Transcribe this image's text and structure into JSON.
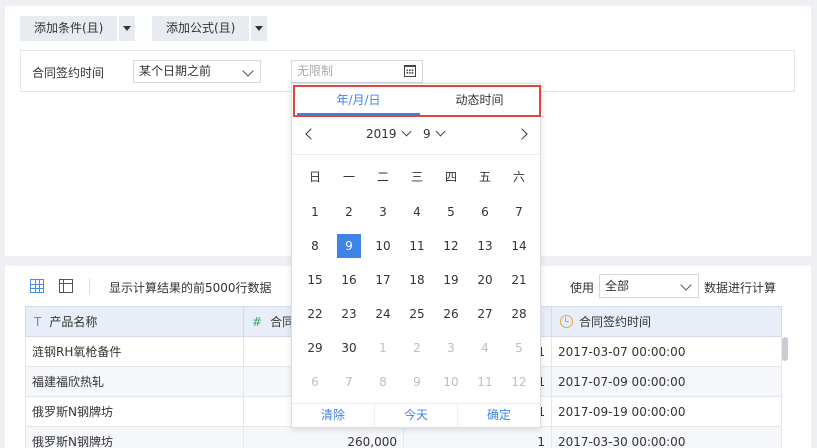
{
  "toolbar": {
    "add_condition_label": "添加条件(且)",
    "add_formula_label": "添加公式(且)"
  },
  "filter": {
    "field_label": "合同签约时间",
    "operator_value": "某个日期之前",
    "date_placeholder": "无限制"
  },
  "datepicker": {
    "tabs": [
      "年/月/日",
      "动态时间"
    ],
    "active_tab": "年/月/日",
    "year": "2019",
    "month": "9",
    "weekdays": [
      "日",
      "一",
      "二",
      "三",
      "四",
      "五",
      "六"
    ],
    "days": [
      {
        "d": "1",
        "o": false
      },
      {
        "d": "2",
        "o": false
      },
      {
        "d": "3",
        "o": false
      },
      {
        "d": "4",
        "o": false
      },
      {
        "d": "5",
        "o": false
      },
      {
        "d": "6",
        "o": false
      },
      {
        "d": "7",
        "o": false
      },
      {
        "d": "8",
        "o": false
      },
      {
        "d": "9",
        "o": false,
        "s": true
      },
      {
        "d": "10",
        "o": false
      },
      {
        "d": "11",
        "o": false
      },
      {
        "d": "12",
        "o": false
      },
      {
        "d": "13",
        "o": false
      },
      {
        "d": "14",
        "o": false
      },
      {
        "d": "15",
        "o": false
      },
      {
        "d": "16",
        "o": false
      },
      {
        "d": "17",
        "o": false
      },
      {
        "d": "18",
        "o": false
      },
      {
        "d": "19",
        "o": false
      },
      {
        "d": "20",
        "o": false
      },
      {
        "d": "21",
        "o": false
      },
      {
        "d": "22",
        "o": false
      },
      {
        "d": "23",
        "o": false
      },
      {
        "d": "24",
        "o": false
      },
      {
        "d": "25",
        "o": false
      },
      {
        "d": "26",
        "o": false
      },
      {
        "d": "27",
        "o": false
      },
      {
        "d": "28",
        "o": false
      },
      {
        "d": "29",
        "o": false
      },
      {
        "d": "30",
        "o": false
      },
      {
        "d": "1",
        "o": true
      },
      {
        "d": "2",
        "o": true
      },
      {
        "d": "3",
        "o": true
      },
      {
        "d": "4",
        "o": true
      },
      {
        "d": "5",
        "o": true
      },
      {
        "d": "6",
        "o": true
      },
      {
        "d": "7",
        "o": true
      },
      {
        "d": "8",
        "o": true
      },
      {
        "d": "9",
        "o": true
      },
      {
        "d": "10",
        "o": true
      },
      {
        "d": "11",
        "o": true
      },
      {
        "d": "12",
        "o": true
      }
    ],
    "footer": {
      "clear": "清除",
      "today": "今天",
      "confirm": "确定"
    }
  },
  "preview": {
    "info_text": "显示计算结果的前5000行数据",
    "use_label": "使用",
    "use_value": "全部",
    "use_suffix": "数据进行计算",
    "columns": [
      {
        "type": "T",
        "label": "产品名称"
      },
      {
        "type": "#",
        "label": "合同"
      },
      {
        "type": "",
        "label": ""
      },
      {
        "type": "clock",
        "label": "合同签约时间"
      }
    ],
    "rows": [
      [
        "涟钢RH氧枪备件",
        "",
        "1",
        "2017-03-07 00:00:00"
      ],
      [
        "福建福欣热轧",
        "",
        "1",
        "2017-07-09 00:00:00"
      ],
      [
        "俄罗斯N钢牌坊",
        "",
        "1",
        "2017-09-19 00:00:00"
      ],
      [
        "俄罗斯N钢牌坊",
        "260,000",
        "1",
        "2017-03-30 00:00:00"
      ]
    ]
  },
  "colors": {
    "accent": "#3d84e6",
    "highlight_border": "#e0453d"
  }
}
